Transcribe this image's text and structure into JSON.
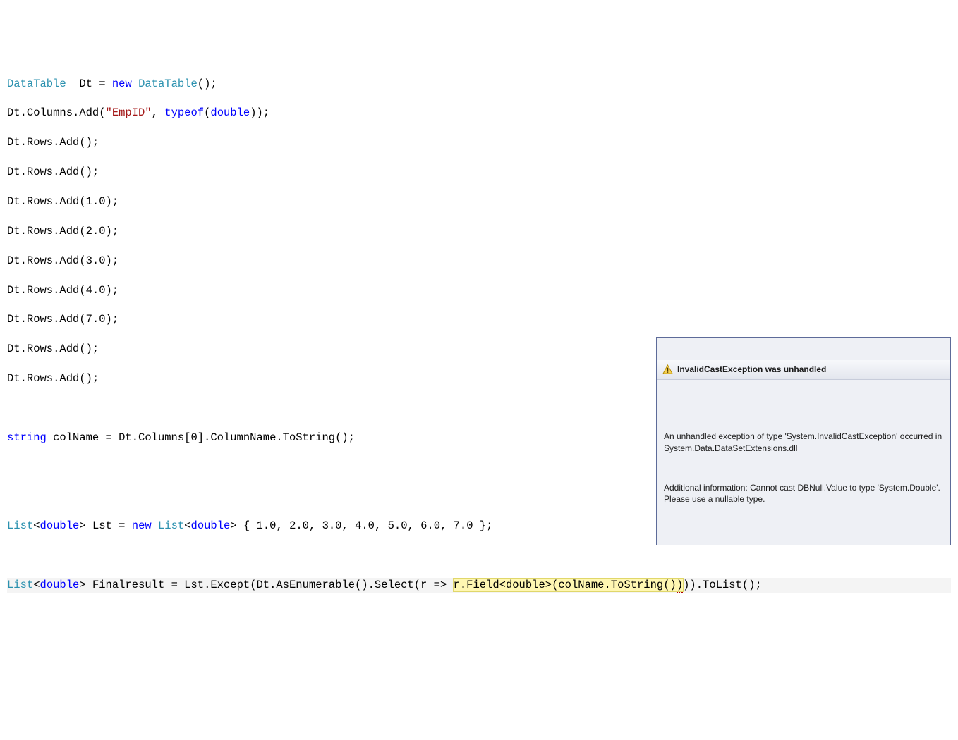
{
  "code": {
    "line1_type": "DataTable",
    "line1_decl": "  Dt = ",
    "line1_new": "new",
    "line1_rest": " DataTable();",
    "line2a": "Dt.Columns.Add(",
    "line2_str": "\"EmpID\"",
    "line2b": ", ",
    "line2_typeof": "typeof",
    "line2c": "(",
    "line2_double": "double",
    "line2d": "));",
    "line3": "Dt.Rows.Add();",
    "line4": "Dt.Rows.Add();",
    "line5": "Dt.Rows.Add(1.0);",
    "line6": "Dt.Rows.Add(2.0);",
    "line7": "Dt.Rows.Add(3.0);",
    "line8": "Dt.Rows.Add(4.0);",
    "line9": "Dt.Rows.Add(7.0);",
    "line10": "Dt.Rows.Add();",
    "line11": "Dt.Rows.Add();",
    "line12_kw": "string",
    "line12_rest": " colName = Dt.Columns[0].ColumnName.ToString();",
    "line13_list": "List",
    "line13_open": "<",
    "line13_double": "double",
    "line13_close": ">",
    "line13_mid1": " Lst = ",
    "line13_new": "new",
    "line13_mid2": " ",
    "line13_list2": "List",
    "line13_rest": " { 1.0, 2.0, 3.0, 4.0, 5.0, 6.0, 7.0 };",
    "line14_list": "List",
    "line14_open": "<",
    "line14_double": "double",
    "line14_close": ">",
    "line14_mid": " Finalresult = Lst.Except(Dt.AsEnumerable().Select(r => ",
    "line14_hl": "r.Field<double>(colName.ToString()",
    "line14_hl_err": ")",
    "line14_end": ")).ToList();"
  },
  "exception": {
    "title": "InvalidCastException was unhandled",
    "body1": "An unhandled exception of type 'System.InvalidCastException' occurred in System.Data.DataSetExtensions.dll",
    "body2": "Additional information: Cannot cast DBNull.Value to type 'System.Double'. Please use a nullable type."
  }
}
